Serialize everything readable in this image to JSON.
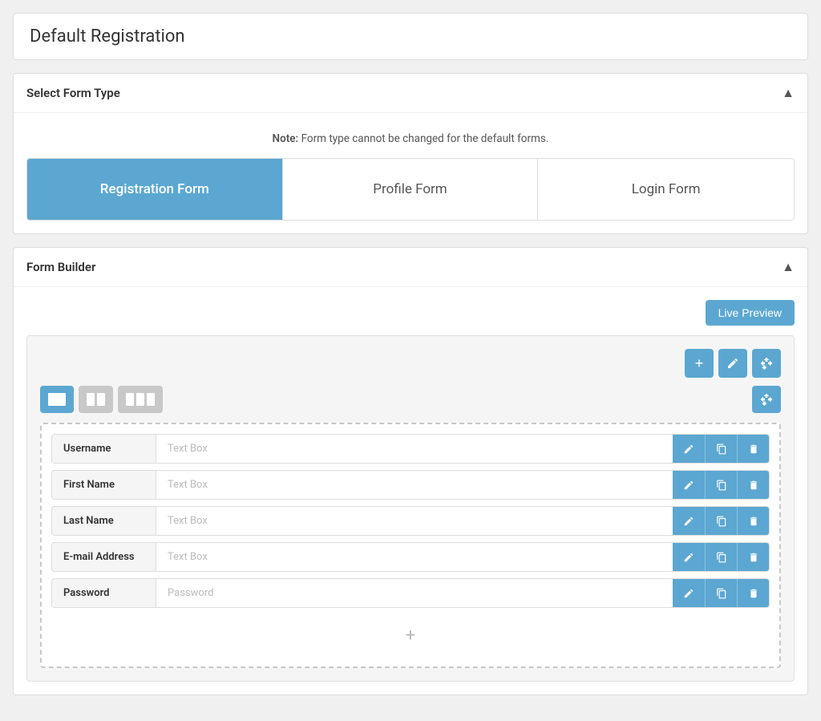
{
  "page": {
    "title": "Default Registration"
  },
  "select_form_type": {
    "section_title": "Select Form Type",
    "note": "Note: Form type cannot be changed for the default forms.",
    "forms": [
      {
        "label": "Registration Form",
        "active": true
      },
      {
        "label": "Profile Form",
        "active": false
      },
      {
        "label": "Login Form",
        "active": false
      }
    ]
  },
  "form_builder": {
    "section_title": "Form Builder",
    "live_preview_label": "Live Preview",
    "fields": [
      {
        "label": "Username",
        "placeholder": "Text Box"
      },
      {
        "label": "First Name",
        "placeholder": "Text Box"
      },
      {
        "label": "Last Name",
        "placeholder": "Text Box"
      },
      {
        "label": "E-mail Address",
        "placeholder": "Text Box"
      },
      {
        "label": "Password",
        "placeholder": "Password"
      }
    ]
  },
  "icons": {
    "chevron_up": "▲",
    "plus": "+",
    "pencil": "✎",
    "copy": "⧉",
    "trash": "🗑",
    "move": "✥"
  },
  "colors": {
    "accent": "#5ba7d1",
    "inactive": "#c8c8c8"
  }
}
